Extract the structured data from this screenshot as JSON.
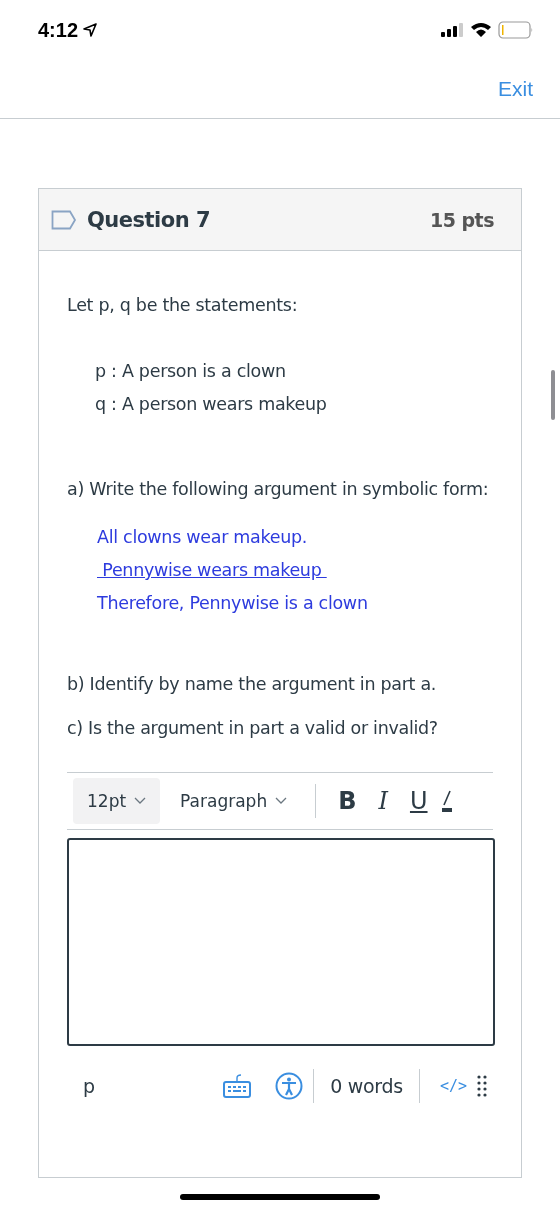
{
  "status_bar": {
    "time": "4:12"
  },
  "header": {
    "exit": "Exit"
  },
  "question": {
    "title": "Question 7",
    "points": "15 pts",
    "intro": "Let p, q be the statements:",
    "statements": [
      "p : A person is a clown",
      "q : A person wears makeup"
    ],
    "part_a": "a) Write the following argument in symbolic form:",
    "argument": [
      {
        "text": "All clowns wear makeup.",
        "underline": false
      },
      {
        "text": " Pennywise wears makeup ",
        "underline": true
      },
      {
        "text": "Therefore, Pennywise is a clown",
        "underline": false
      }
    ],
    "part_b": "b) Identify by name the argument in part a.",
    "part_c": "c) Is the argument in part a valid or invalid?"
  },
  "editor": {
    "font_size": "12pt",
    "block_format": "Paragraph",
    "format_buttons": [
      {
        "label": "B",
        "kind": "bold"
      },
      {
        "label": "I",
        "kind": "italic"
      },
      {
        "label": "U",
        "kind": "underline"
      }
    ],
    "path": "p",
    "word_count": "0 words",
    "html_toggle": "</>"
  }
}
